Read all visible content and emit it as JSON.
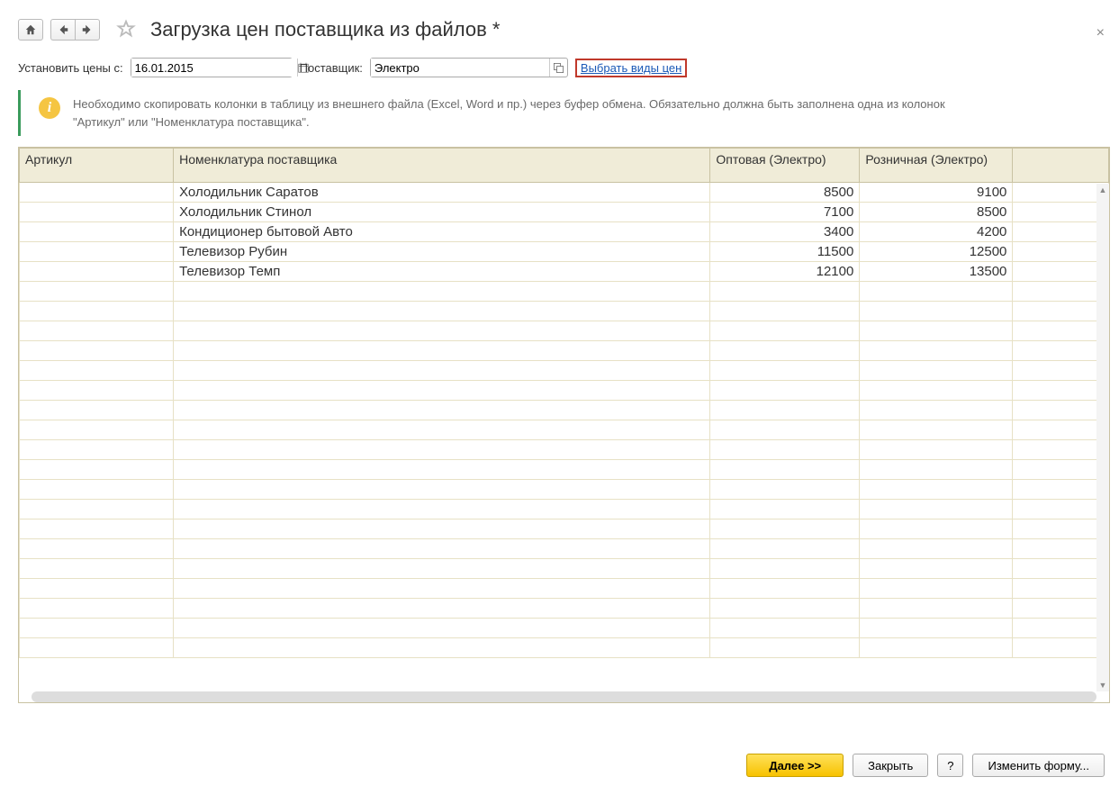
{
  "title": "Загрузка цен поставщика из файлов *",
  "close_glyph": "×",
  "params": {
    "date_label": "Установить цены с:",
    "date_value": "16.01.2015",
    "supplier_label": "Поставщик:",
    "supplier_value": "Электро",
    "select_price_types": "Выбрать виды цен"
  },
  "info": {
    "icon_text": "i",
    "text": "Необходимо скопировать колонки в таблицу из внешнего файла (Excel, Word и пр.) через буфер обмена. Обязательно должна быть заполнена одна из колонок \"Артикул\" или \"Номенклатура поставщика\"."
  },
  "columns": {
    "article": "Артикул",
    "nomenclature": "Номенклатура поставщика",
    "price1": "Оптовая (Электро)",
    "price2": "Розничная (Электро)"
  },
  "rows": [
    {
      "article": "",
      "nomenclature": "Холодильник Саратов",
      "p1": "8500",
      "p2": "9100"
    },
    {
      "article": "",
      "nomenclature": "Холодильник Стинол",
      "p1": "7100",
      "p2": "8500"
    },
    {
      "article": "",
      "nomenclature": "Кондиционер бытовой Авто",
      "p1": "3400",
      "p2": "4200"
    },
    {
      "article": "",
      "nomenclature": "Телевизор Рубин",
      "p1": "11500",
      "p2": "12500"
    },
    {
      "article": "",
      "nomenclature": "Телевизор Темп",
      "p1": "12100",
      "p2": "13500"
    }
  ],
  "empty_rows": 19,
  "footer": {
    "next": "Далее >>",
    "close": "Закрыть",
    "help": "?",
    "edit_form": "Изменить форму..."
  },
  "scroll_arrows": {
    "up": "▲",
    "down": "▼"
  }
}
